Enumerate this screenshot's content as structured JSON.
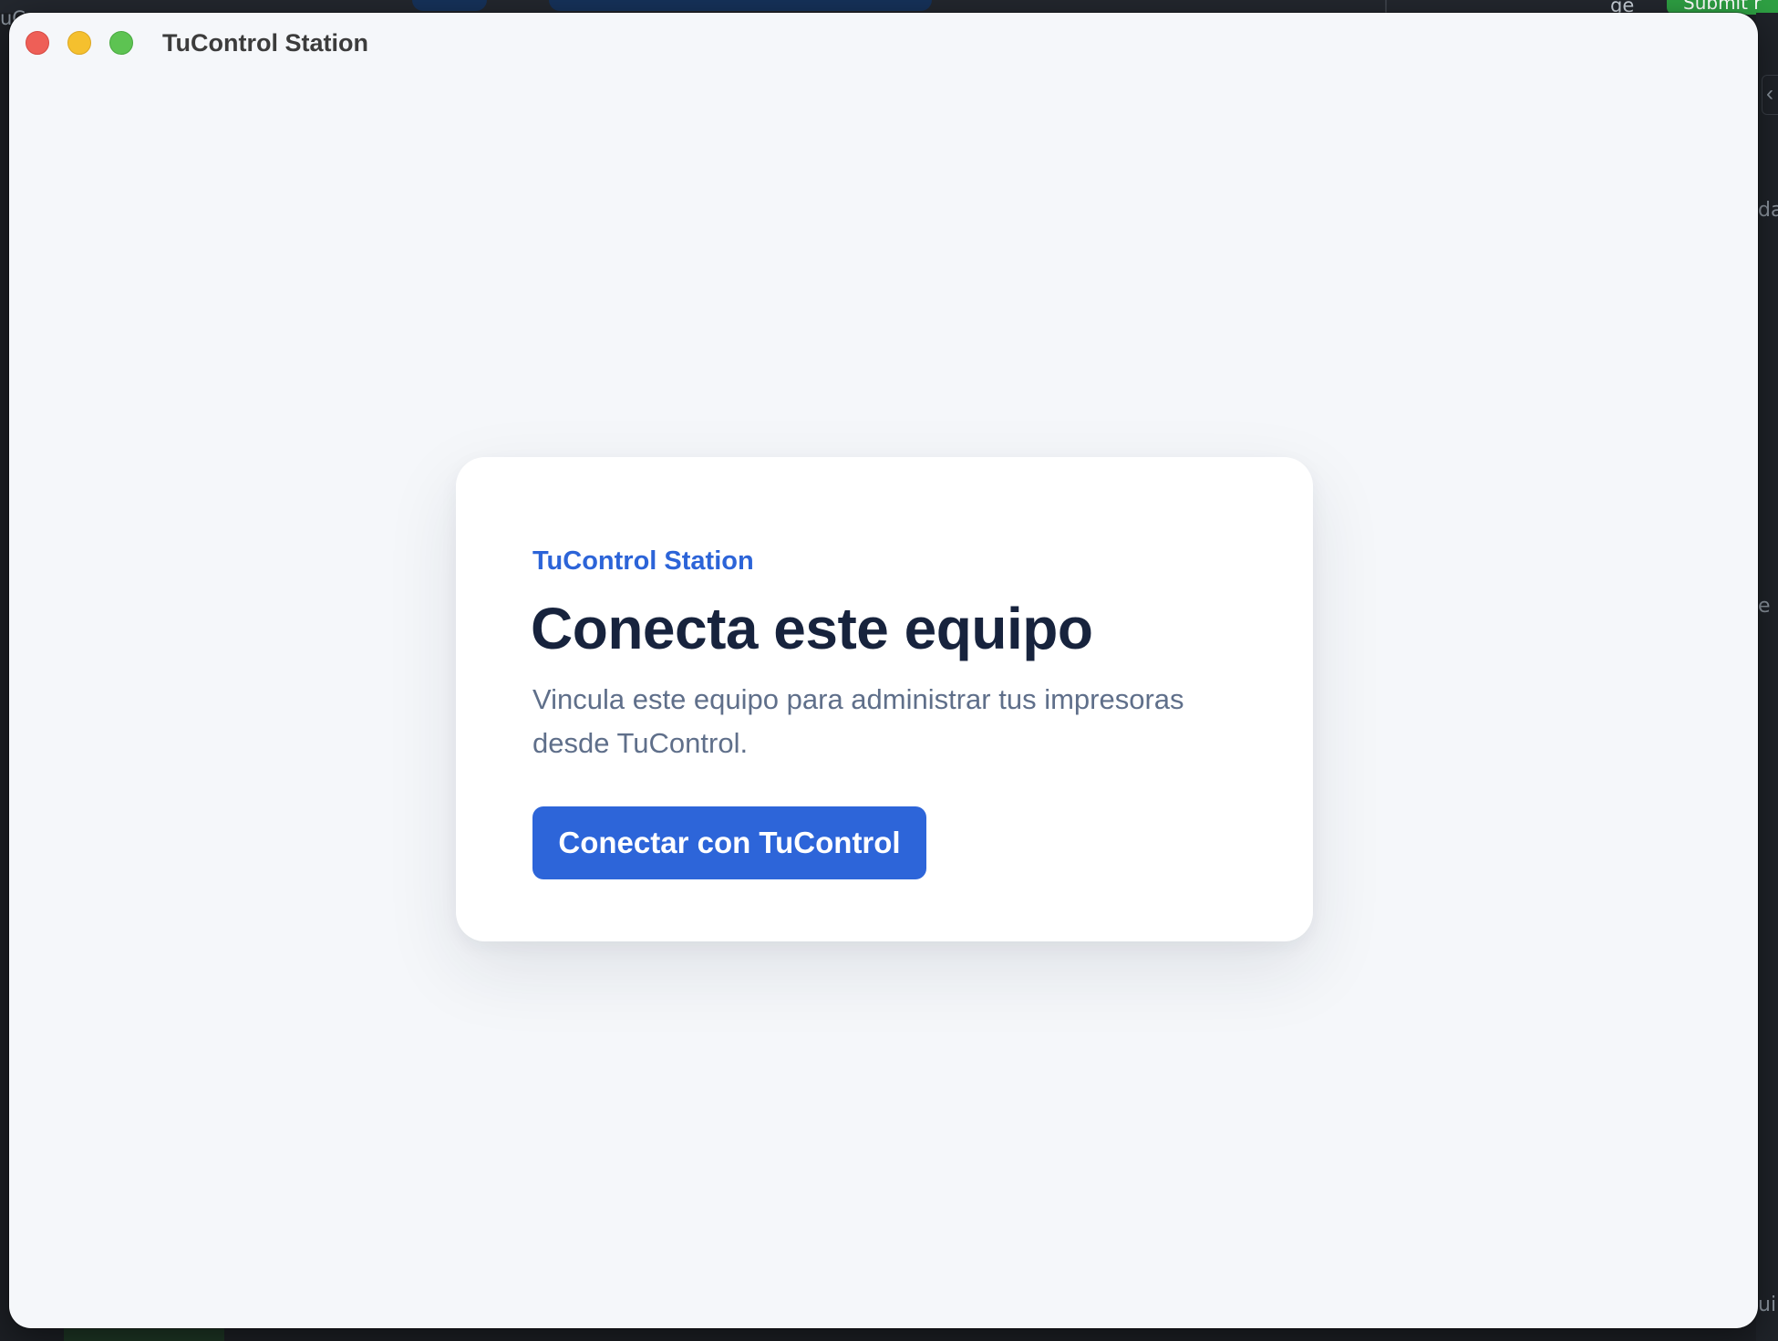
{
  "background": {
    "left_fragment": "uC",
    "right_word": "ge",
    "submit_label": "Submit r",
    "side_fragments": [
      "da",
      "e",
      "ui"
    ],
    "bottom_text": "......."
  },
  "window": {
    "title": "TuControl Station"
  },
  "card": {
    "eyebrow": "TuControl Station",
    "title": "Conecta este equipo",
    "description": "Vincula este equipo para administrar tus impresoras desde TuControl.",
    "button_label": "Conectar con TuControl"
  },
  "colors": {
    "accent": "#2d65d9",
    "title_text": "#17233d",
    "body_text": "#5f6f8a",
    "window_bg": "#f5f7fa",
    "close": "#ee5f57",
    "minimize": "#f5c02e",
    "maximize": "#5dc352"
  }
}
